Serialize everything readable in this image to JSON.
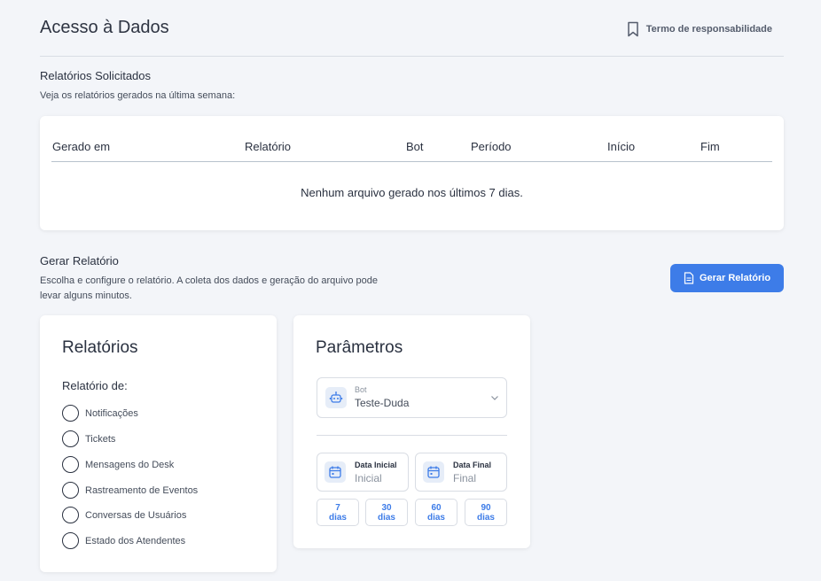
{
  "header": {
    "title": "Acesso à Dados",
    "terms_link": "Termo de responsabilidade",
    "terms_icon": "bookmark-icon"
  },
  "reports_requested": {
    "title": "Relatórios Solicitados",
    "subtitle": "Veja os relatórios gerados na última semana:",
    "columns": [
      "Gerado em",
      "Relatório",
      "Bot",
      "Período",
      "Início",
      "Fim"
    ],
    "empty_message": "Nenhum arquivo gerado nos últimos 7 dias."
  },
  "generate": {
    "title": "Gerar Relatório",
    "subtitle_line1": "Escolha e configure o relatório. A coleta dos dados e geração do arquivo pode",
    "subtitle_line2": "levar alguns minutos.",
    "button_label": "Gerar Relatório",
    "button_icon": "document-icon",
    "accent_color": "#3d7ce8"
  },
  "reports_card": {
    "heading": "Relatórios",
    "label": "Relatório de:",
    "options": [
      "Notificações",
      "Tickets",
      "Mensagens do Desk",
      "Rastreamento de Eventos",
      "Conversas de Usuários",
      "Estado dos Atendentes"
    ]
  },
  "params_card": {
    "heading": "Parâmetros",
    "bot_caption": "Bot",
    "bot_value": "Teste-Duda",
    "bot_icon": "robot-icon",
    "start_date_caption": "Data Inicial",
    "start_date_placeholder": "Inicial",
    "end_date_caption": "Data Final",
    "end_date_placeholder": "Final",
    "date_icon": "calendar-icon",
    "presets": [
      {
        "num": "7",
        "unit": "dias"
      },
      {
        "num": "30",
        "unit": "dias"
      },
      {
        "num": "60",
        "unit": "dias"
      },
      {
        "num": "90",
        "unit": "dias"
      }
    ]
  }
}
